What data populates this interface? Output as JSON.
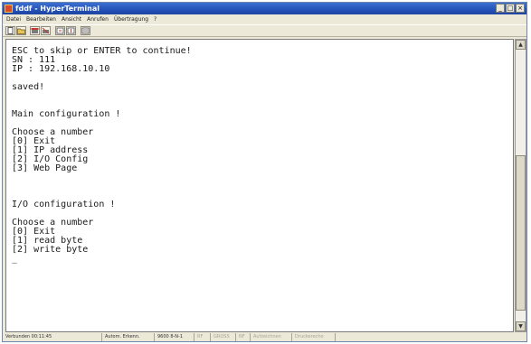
{
  "window": {
    "title": "fddf - HyperTerminal",
    "minimize_glyph": "_",
    "maximize_glyph": "□",
    "close_glyph": "×"
  },
  "menu": {
    "items": [
      "Datei",
      "Bearbeiten",
      "Ansicht",
      "Anrufen",
      "Übertragung",
      "?"
    ]
  },
  "toolbar": {
    "icons": [
      "new-document-icon",
      "open-folder-icon",
      "phone-icon",
      "disconnect-icon",
      "send-icon",
      "receive-icon",
      "properties-icon"
    ]
  },
  "terminal": {
    "lines": [
      "ESC to skip or ENTER to continue!",
      "SN : 111",
      "IP : 192.168.10.10",
      "",
      "saved!",
      "",
      "",
      "Main configuration !",
      "",
      "Choose a number",
      "[0] Exit",
      "[1] IP address",
      "[2] I/O Config",
      "[3] Web Page",
      "",
      "",
      "",
      "I/O configuration !",
      "",
      "Choose a number",
      "[0] Exit",
      "[1] read byte",
      "[2] write byte"
    ],
    "cursor": "_"
  },
  "scrollbar": {
    "up_glyph": "▲",
    "down_glyph": "▼"
  },
  "status": {
    "connected": "Verbunden 00:11:45",
    "detect": "Autom. Erkenn.",
    "settings": "9600 8-N-1",
    "scroll": "RF",
    "caps": "GROSS",
    "num": "NF",
    "capture": "Aufzeichnen",
    "print": "Druckerecho"
  }
}
